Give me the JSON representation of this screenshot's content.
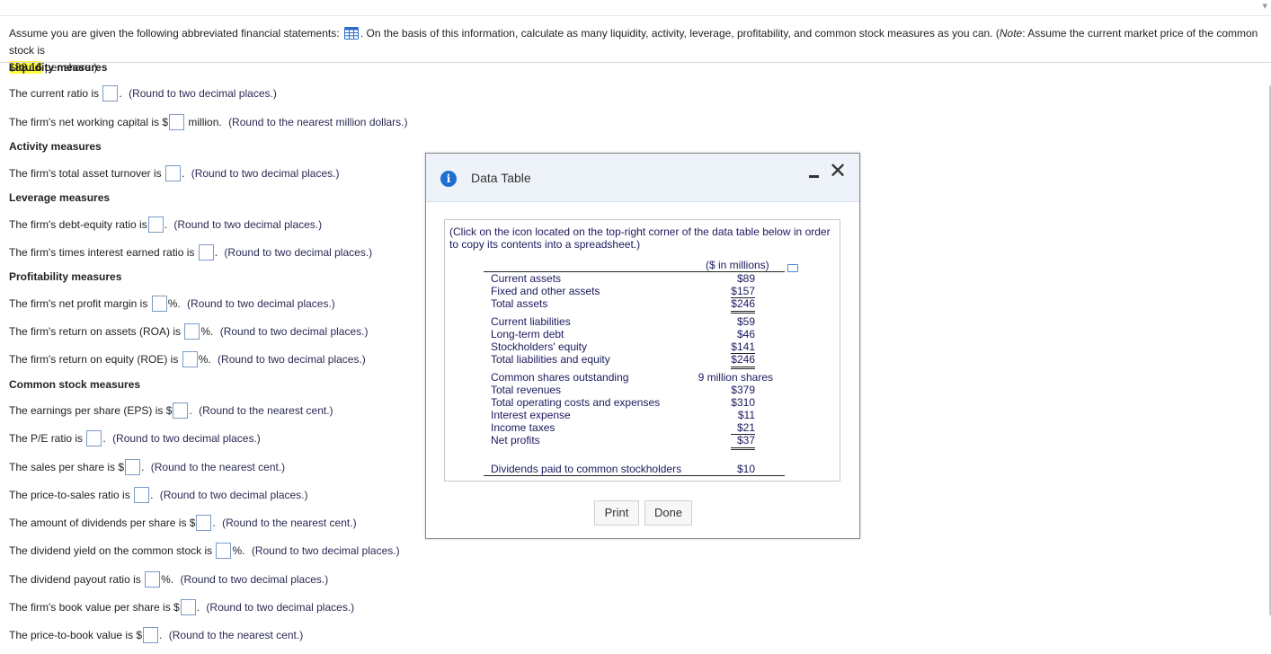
{
  "question": {
    "part1": "Assume you are given the following abbreviated financial statements:",
    "part2": ". On the basis of this information, calculate as many liquidity, activity, leverage, profitability, and common stock measures as you can. (",
    "note_word": "Note",
    "part3": ": Assume the current market price of the common stock is",
    "price": "$88.16",
    "part4": " per share.)"
  },
  "sections": {
    "liquidity": "Liquidity measures",
    "activity": "Activity measures",
    "leverage": "Leverage measures",
    "profitability": "Profitability measures",
    "common_stock": "Common stock measures"
  },
  "items": {
    "current_ratio": {
      "pre": "The current ratio is",
      "post": ".",
      "hint": "(Round to two decimal places.)"
    },
    "nwc": {
      "pre": "The firm's net working capital is $",
      "post": " million.",
      "hint": "(Round to the nearest million dollars.)"
    },
    "tat": {
      "pre": "The firm's total asset turnover is",
      "post": ".",
      "hint": "(Round to two decimal places.)"
    },
    "de": {
      "pre": "The firm's debt-equity ratio is",
      "post": ".",
      "hint": "(Round to two decimal places.)"
    },
    "tie": {
      "pre": "The firm's times interest earned ratio is",
      "post": ".",
      "hint": "(Round to two decimal places.)"
    },
    "npm": {
      "pre": "The firm's net profit margin is",
      "post": "%.",
      "hint": "(Round to two decimal places.)"
    },
    "roa": {
      "pre": "The firm's return on assets (ROA) is",
      "post": "%.",
      "hint": "(Round to two decimal places.)"
    },
    "roe": {
      "pre": "The firm's return on equity (ROE) is",
      "post": "%.",
      "hint": "(Round to two decimal places.)"
    },
    "eps": {
      "pre": "The earnings per share (EPS) is $",
      "post": ".",
      "hint": "(Round to the nearest cent.)"
    },
    "pe": {
      "pre": "The P/E ratio is",
      "post": ".",
      "hint": "(Round to two decimal places.)"
    },
    "sps": {
      "pre": "The sales per share is $",
      "post": ".",
      "hint": "(Round to the nearest cent.)"
    },
    "ps": {
      "pre": "The price-to-sales ratio is",
      "post": ".",
      "hint": "(Round to two decimal places.)"
    },
    "dps": {
      "pre": "The amount of dividends per share is $",
      "post": ".",
      "hint": "(Round to the nearest cent.)"
    },
    "dy": {
      "pre": "The dividend yield on the common stock is",
      "post": "%.",
      "hint": "(Round to two decimal places.)"
    },
    "dpr": {
      "pre": "The dividend payout ratio is",
      "post": "%.",
      "hint": "(Round to two decimal places.)"
    },
    "bvps": {
      "pre": "The firm's book value per share is $",
      "post": ".",
      "hint": "(Round to two decimal places.)"
    },
    "pb": {
      "pre": "The price-to-book value is $",
      "post": ".",
      "hint": "(Round to the nearest cent.)"
    }
  },
  "modal": {
    "title": "Data Table",
    "note": "(Click on the icon located on the top-right corner of the data table below in order to copy its contents into a spreadsheet.)",
    "header": "($ in millions)",
    "rows": [
      {
        "label": "Current assets",
        "value": "$89"
      },
      {
        "label": "Fixed and other assets",
        "value": "$157"
      },
      {
        "label": "Total assets",
        "value": "$246"
      },
      {
        "label": "Current liabilities",
        "value": "$59"
      },
      {
        "label": "Long-term debt",
        "value": "$46"
      },
      {
        "label": "Stockholders' equity",
        "value": "$141"
      },
      {
        "label": "Total liabilities and equity",
        "value": "$246"
      },
      {
        "label": "Common shares outstanding",
        "value": "9 million shares"
      },
      {
        "label": "Total revenues",
        "value": "$379"
      },
      {
        "label": "Total operating costs and expenses",
        "value": "$310"
      },
      {
        "label": "Interest expense",
        "value": "$11"
      },
      {
        "label": "Income taxes",
        "value": "$21"
      },
      {
        "label": "Net profits",
        "value": "$37"
      },
      {
        "label": "Dividends paid to common stockholders",
        "value": "$10"
      }
    ],
    "print_label": "Print",
    "done_label": "Done"
  },
  "colors": {
    "highlight": "#ffff3b",
    "info_icon": "#1f6fd1",
    "modal_header": "#eef3fa"
  }
}
